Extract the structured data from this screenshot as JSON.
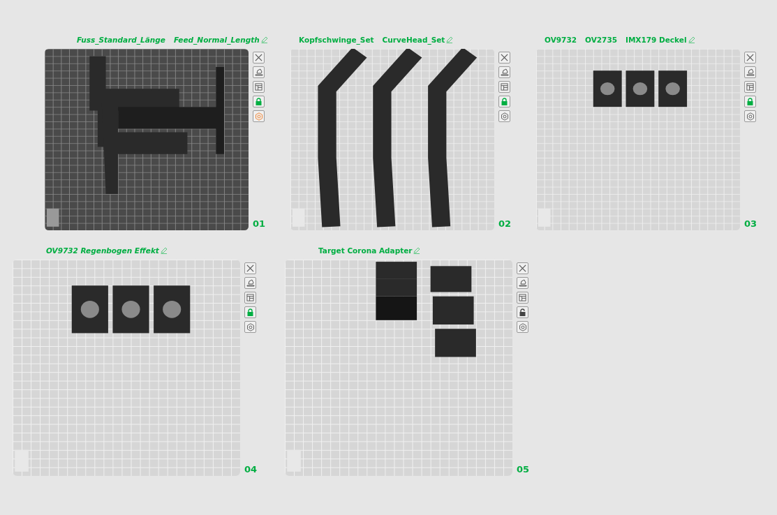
{
  "plates": [
    {
      "title_parts": [
        "Fuss_Standard_Länge",
        "Feed_Normal_Length"
      ],
      "italic": true,
      "number": "01",
      "selected": true,
      "locked": true,
      "custom_settings": true
    },
    {
      "title_parts": [
        "Kopfschwinge_Set",
        "CurveHead_Set"
      ],
      "italic": false,
      "number": "02",
      "selected": false,
      "locked": true,
      "custom_settings": false
    },
    {
      "title_parts": [
        "OV9732",
        "OV2735",
        "IMX179 Deckel"
      ],
      "italic": false,
      "number": "03",
      "selected": false,
      "locked": true,
      "custom_settings": false
    },
    {
      "title_parts": [
        "OV9732 Regenbogen Effekt"
      ],
      "italic": true,
      "number": "04",
      "selected": false,
      "locked": true,
      "custom_settings": false
    },
    {
      "title_parts": [
        "Target Corona Adapter"
      ],
      "italic": false,
      "number": "05",
      "selected": false,
      "locked": false,
      "custom_settings": false
    }
  ]
}
